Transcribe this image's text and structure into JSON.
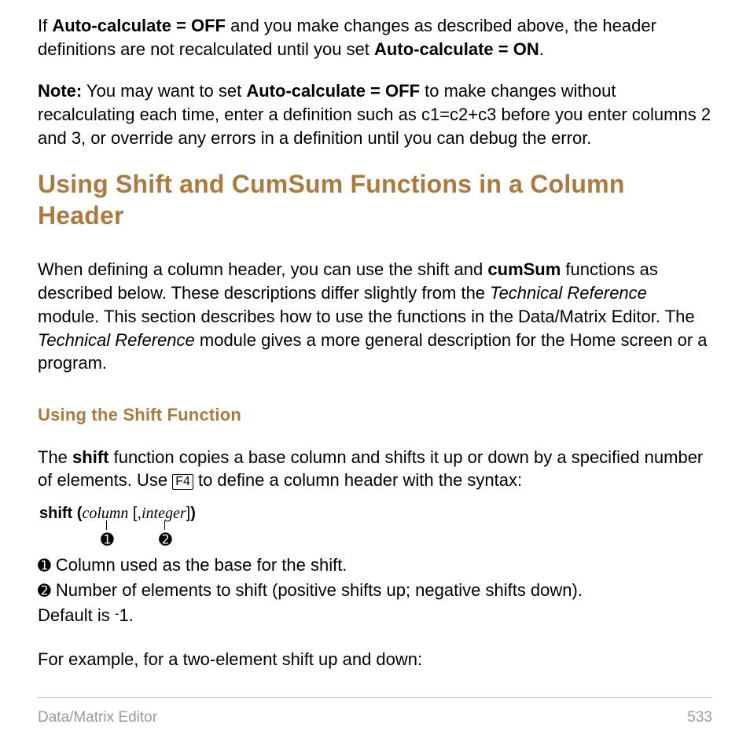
{
  "p1": {
    "t1": "If ",
    "b1": "Auto-calculate = OFF",
    "t2": " and you make changes as described above, the header definitions are not recalculated until you set ",
    "b2": "Auto-calculate = ON",
    "t3": "."
  },
  "p2": {
    "b1": "Note:",
    "t1": " You may want to set ",
    "b2": "Auto-calculate = OFF",
    "t2": " to make changes without recalculating each time, enter a definition such as c1=c2+c3 before you enter columns 2 and 3, or override any errors in a definition until you can debug the error."
  },
  "h1": "Using Shift and CumSum Functions in a Column Header",
  "p3": {
    "t1": "When defining a column header, you can use the shift and ",
    "b1": "cumSum",
    "t2": " functions as described below. These descriptions differ slightly from the ",
    "i1": "Technical Reference",
    "t3": " module. This section describes how to use the functions in the Data/Matrix Editor.  The ",
    "i2": "Technical Reference",
    "t4": " module gives a more general description for the Home screen or a program."
  },
  "h2": "Using the Shift Function",
  "p4": {
    "t1": "The ",
    "b1": "shift",
    "t2": " function copies a base column and shifts it up or down by a specified number of elements. Use ",
    "key": "F4",
    "t3": " to define a column header with the syntax:"
  },
  "syntax": {
    "s1": "shift (",
    "i1": "column",
    "s2": " [,",
    "i2": "integer",
    "s3": "]",
    "s4": ")",
    "c1": "➊",
    "c2": "➋"
  },
  "legend": {
    "l1a": "➊",
    "l1b": " Column used as the base for the shift.",
    "l2a": "➋",
    "l2b": " Number of elements to shift (positive shifts up; negative shifts down).",
    "l3": "Default is ",
    "neg": "-",
    "l3b": "1."
  },
  "p5": "For example, for a two-element shift up and down:",
  "footer": {
    "left": "Data/Matrix Editor",
    "right": "533"
  }
}
